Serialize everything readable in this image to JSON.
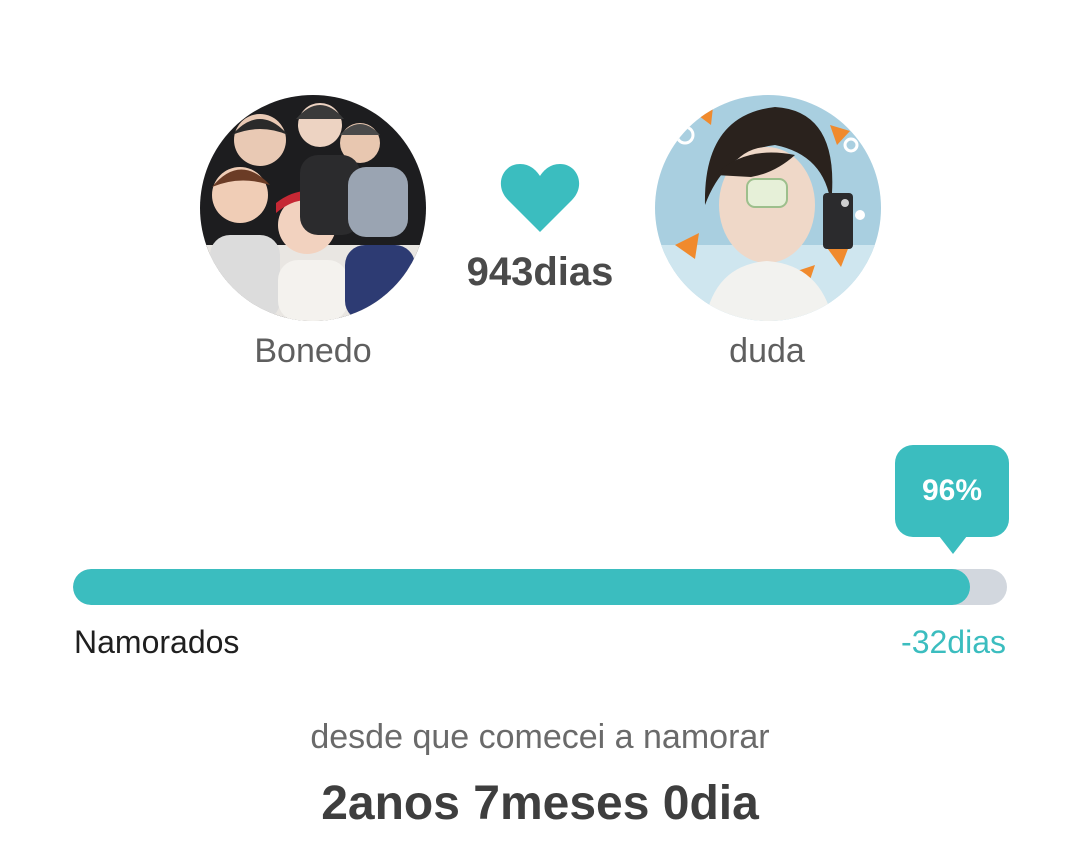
{
  "couple": {
    "left": {
      "name": "Bonedo",
      "avatar_icon": "group-photo-avatar"
    },
    "right": {
      "name": "duda",
      "avatar_icon": "portrait-photo-avatar"
    },
    "heart_icon": "heart-icon",
    "days_together": "943dias"
  },
  "progress": {
    "percent_label": "96%",
    "percent_value": 0.96,
    "left_label": "Namorados",
    "right_label": "-32dias"
  },
  "summary": {
    "caption": "desde que comecei a namorar",
    "duration": "2anos 7meses 0dia"
  },
  "colors": {
    "accent": "#3bbdbf",
    "track": "#d2d7de",
    "text_dark": "#3e3e3e",
    "text_muted": "#6a6a6a"
  }
}
